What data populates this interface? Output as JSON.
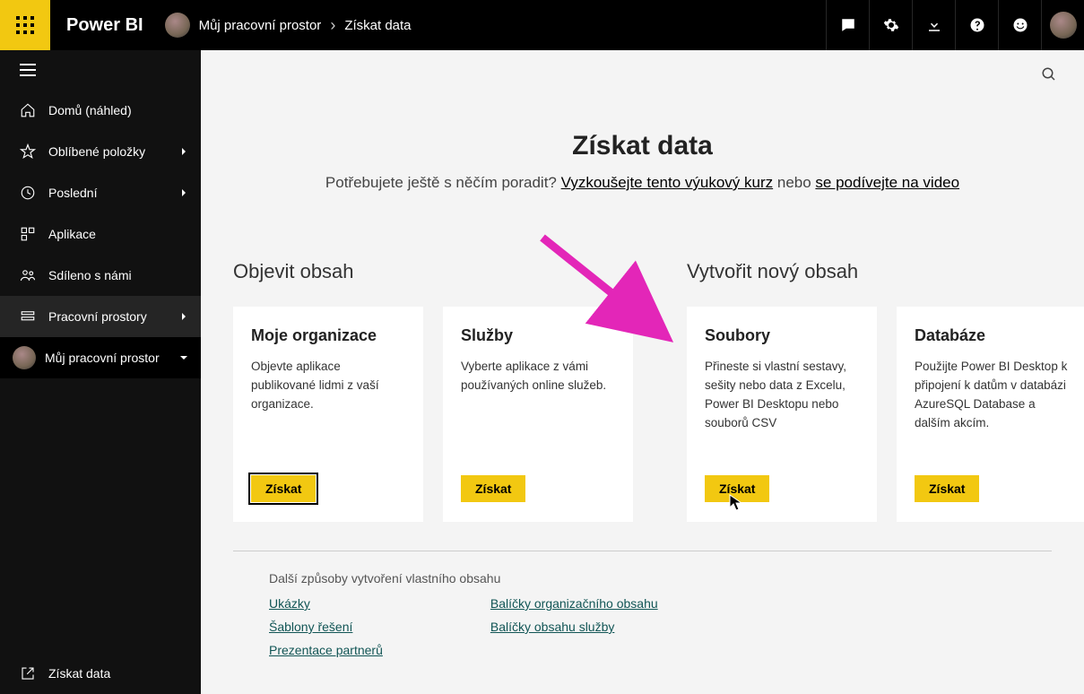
{
  "header": {
    "brand": "Power BI",
    "breadcrumb_workspace": "Můj pracovní prostor",
    "breadcrumb_page": "Získat data"
  },
  "sidebar": {
    "home": "Domů (náhled)",
    "favorites": "Oblíbené položky",
    "recent": "Poslední",
    "apps": "Aplikace",
    "shared": "Sdíleno s námi",
    "workspaces": "Pracovní prostory",
    "myworkspace": "Můj pracovní prostor",
    "getdata": "Získat data"
  },
  "main": {
    "title": "Získat data",
    "subtitle_pre": "Potřebujete ještě s něčím poradit? ",
    "subtitle_link1": "Vyzkoušejte tento výukový kurz",
    "subtitle_mid": " nebo ",
    "subtitle_link2": "se podívejte na video",
    "section1_title": "Objevit obsah",
    "section2_title": "Vytvořit nový obsah",
    "cards": {
      "org": {
        "title": "Moje organizace",
        "desc": "Objevte aplikace publikované lidmi z vaší organizace.",
        "btn": "Získat"
      },
      "services": {
        "title": "Služby",
        "desc": "Vyberte aplikace z vámi používaných online služeb.",
        "btn": "Získat"
      },
      "files": {
        "title": "Soubory",
        "desc": "Přineste si vlastní sestavy, sešity nebo data z Excelu, Power BI Desktopu nebo souborů CSV",
        "btn": "Získat"
      },
      "databases": {
        "title": "Databáze",
        "desc": "Použijte Power BI Desktop k připojení k datům v databázi AzureSQL Database a dalším akcím.",
        "btn": "Získat"
      }
    },
    "other_title": "Další způsoby vytvoření vlastního obsahu",
    "other_links": {
      "samples": "Ukázky",
      "templates": "Šablony řešení",
      "partners": "Prezentace partnerů",
      "org_packs": "Balíčky organizačního obsahu",
      "service_packs": "Balíčky obsahu služby"
    }
  }
}
